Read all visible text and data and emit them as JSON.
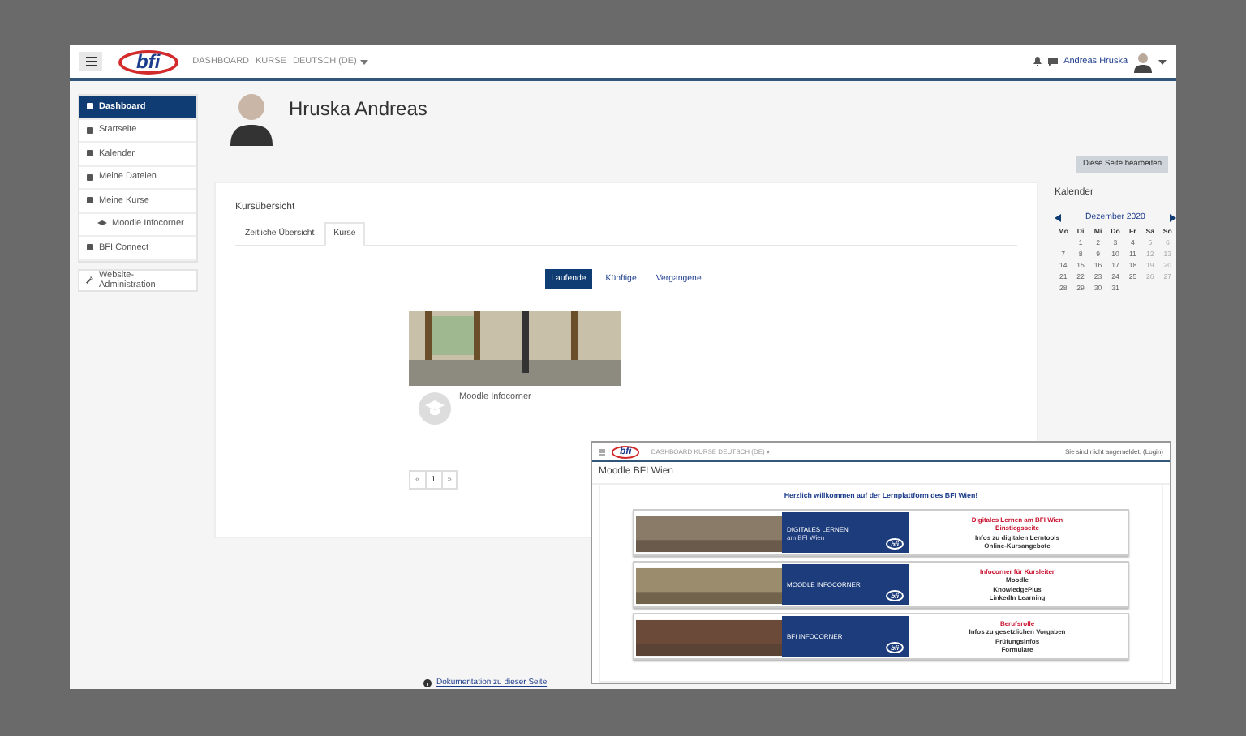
{
  "topbar": {
    "logo": "bfi",
    "nav": [
      {
        "label": "DASHBOARD",
        "dropdown": false
      },
      {
        "label": "KURSE",
        "dropdown": false
      },
      {
        "label": "DEUTSCH (DE)",
        "dropdown": true
      }
    ],
    "user": "Andreas Hruska"
  },
  "sidebar": {
    "items": [
      {
        "label": "Dashboard",
        "selected": true
      },
      {
        "label": "Startseite",
        "selected": false
      },
      {
        "label": "Kalender",
        "selected": false
      },
      {
        "label": "Meine Dateien",
        "selected": false
      },
      {
        "label": "Meine Kurse",
        "selected": false,
        "children": [
          {
            "label": "Moodle Infocorner",
            "selected": false
          }
        ]
      },
      {
        "label": "BFI Connect",
        "selected": false
      }
    ],
    "admin": "Website-Administration"
  },
  "profile": {
    "name": "Hruska Andreas",
    "edit_button": "Diese Seite bearbeiten"
  },
  "course_overview": {
    "title": "Kursübersicht",
    "tabs": [
      {
        "label": "Zeitliche Übersicht",
        "selected": false
      },
      {
        "label": "Kurse",
        "selected": true
      }
    ],
    "filters": [
      {
        "label": "Laufende",
        "selected": true
      },
      {
        "label": "Künftige",
        "selected": false
      },
      {
        "label": "Vergangene",
        "selected": false
      }
    ],
    "courses": [
      {
        "name": "Moodle Infocorner"
      }
    ],
    "pagination": [
      {
        "label": "«",
        "selected": false
      },
      {
        "label": "1",
        "selected": true
      },
      {
        "label": "»",
        "selected": false
      }
    ]
  },
  "calendar": {
    "title": "Kalender",
    "month": "Dezember 2020",
    "weekdays": [
      "Mo",
      "Di",
      "Mi",
      "Do",
      "Fr",
      "Sa",
      "So"
    ],
    "weeks": [
      [
        "1",
        "2",
        "3",
        "4",
        "5",
        "6"
      ],
      [
        "7",
        "8",
        "9",
        "10",
        "11",
        "12",
        "13"
      ],
      [
        "14",
        "15",
        "16",
        "17",
        "18",
        "19",
        "20"
      ],
      [
        "21",
        "22",
        "23",
        "24",
        "25",
        "26",
        "27"
      ],
      [
        "28",
        "29",
        "30",
        "31"
      ]
    ]
  },
  "footer_link": "Dokumentation zu dieser Seite",
  "inset_window": {
    "logo": "bfi",
    "nav": "DASHBOARD KURSE DEUTSCH (DE) ▾",
    "login": "Sie sind nicht angemeldet. (Login)",
    "title": "Moodle BFI Wien",
    "welcome": "Herzlich willkommen auf der Lernplattform des BFI Wien!",
    "banners": [
      {
        "heading": "DIGITALES LERNEN",
        "subheading": "am BFI Wien",
        "logo": "bfi",
        "links": [
          {
            "label": "Digitales Lernen am BFI Wien",
            "kind": "heading"
          },
          {
            "label": "Einstiegsseite",
            "kind": "heading"
          },
          {
            "label": "Infos zu digitalen Lerntools",
            "kind": "link"
          },
          {
            "label": "Online-Kursangebote",
            "kind": "link"
          }
        ]
      },
      {
        "heading": "MOODLE INFOCORNER",
        "logo": "bfi",
        "links": [
          {
            "label": "Infocorner für Kursleiter",
            "kind": "heading"
          },
          {
            "label": "Moodle",
            "kind": "link"
          },
          {
            "label": "KnowledgePlus",
            "kind": "link"
          },
          {
            "label": "LinkedIn Learning",
            "kind": "link"
          }
        ]
      },
      {
        "heading": "BFI INFOCORNER",
        "logo": "bfi",
        "links": [
          {
            "label": "Berufsrolle",
            "kind": "heading"
          },
          {
            "label": "Infos zu gesetzlichen Vorgaben",
            "kind": "link"
          },
          {
            "label": "Prüfungsinfos",
            "kind": "link"
          },
          {
            "label": "Formulare",
            "kind": "link"
          }
        ]
      }
    ]
  }
}
